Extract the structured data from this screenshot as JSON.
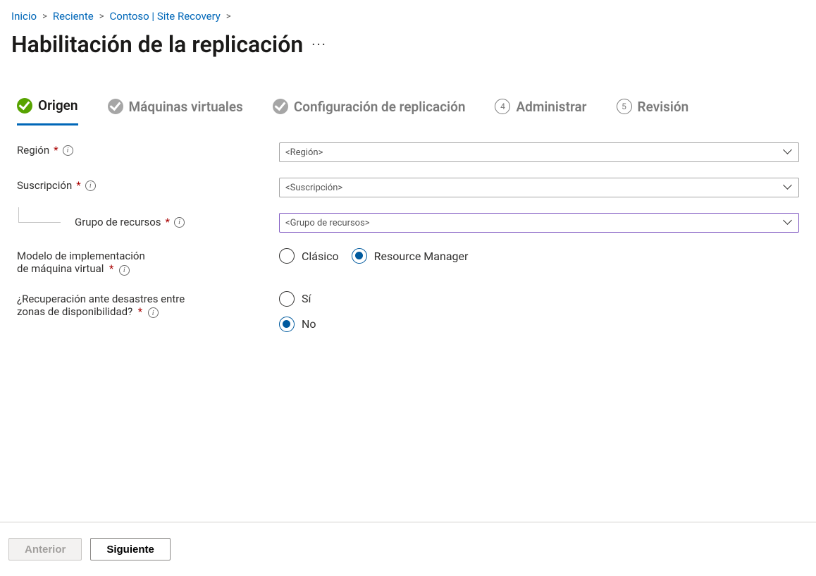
{
  "breadcrumb": {
    "home": "Inicio",
    "recent": "Reciente",
    "vault": "Contoso  | Site Recovery"
  },
  "page": {
    "title": "Habilitación de la replicación",
    "ellipsis": "···"
  },
  "steps": {
    "s1": "Origen",
    "s2": "Máquinas virtuales",
    "s3": "Configuración de replicación",
    "s4": "Administrar",
    "s4_num": "4",
    "s5": "Revisión",
    "s5_num": "5"
  },
  "form": {
    "region": {
      "label": "Región",
      "value": "<Región>"
    },
    "subscription": {
      "label": "Suscripción",
      "value": "<Suscripción>"
    },
    "resource_group": {
      "label": "Grupo de recursos",
      "value": "<Grupo de recursos>"
    },
    "deploy_model": {
      "label_l1": "Modelo de implementación",
      "label_l2": "de máquina virtual",
      "opt_classic": "Clásico",
      "opt_rm": "Resource Manager",
      "selected": "rm"
    },
    "zone_dr": {
      "label_l1": "¿Recuperación ante desastres entre",
      "label_l2": "zonas de disponibilidad?",
      "opt_yes": "Sí",
      "opt_no": "No",
      "selected": "no"
    }
  },
  "footer": {
    "prev": "Anterior",
    "next": "Siguiente"
  },
  "info_glyph": "i"
}
